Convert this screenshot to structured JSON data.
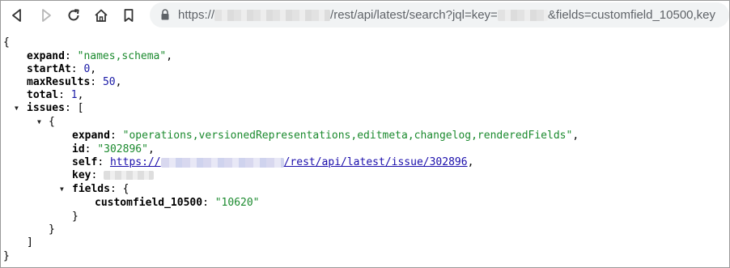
{
  "browser": {
    "url": {
      "scheme": "https://",
      "path": "/rest/api/latest/search?jql=key=",
      "query": "&fields=customfield_10500,key"
    }
  },
  "json": {
    "open_brace": "{",
    "close_brace": "}",
    "expand_key": "expand",
    "expand_value": "\"names,schema\"",
    "startAt_key": "startAt",
    "startAt_value": "0",
    "maxResults_key": "maxResults",
    "maxResults_value": "50",
    "total_key": "total",
    "total_value": "1",
    "issues_key": "issues",
    "open_bracket": "[",
    "close_bracket": "]",
    "issue": {
      "expand_key": "expand",
      "expand_value": "\"operations,versionedRepresentations,editmeta,changelog,renderedFields\"",
      "id_key": "id",
      "id_value": "\"302896\"",
      "self_key": "self",
      "self_scheme": "https://",
      "self_path": "/rest/api/latest/issue/302896",
      "key_key": "key",
      "fields_key": "fields",
      "customfield_key": "customfield_10500",
      "customfield_value": "\"10620\""
    }
  }
}
